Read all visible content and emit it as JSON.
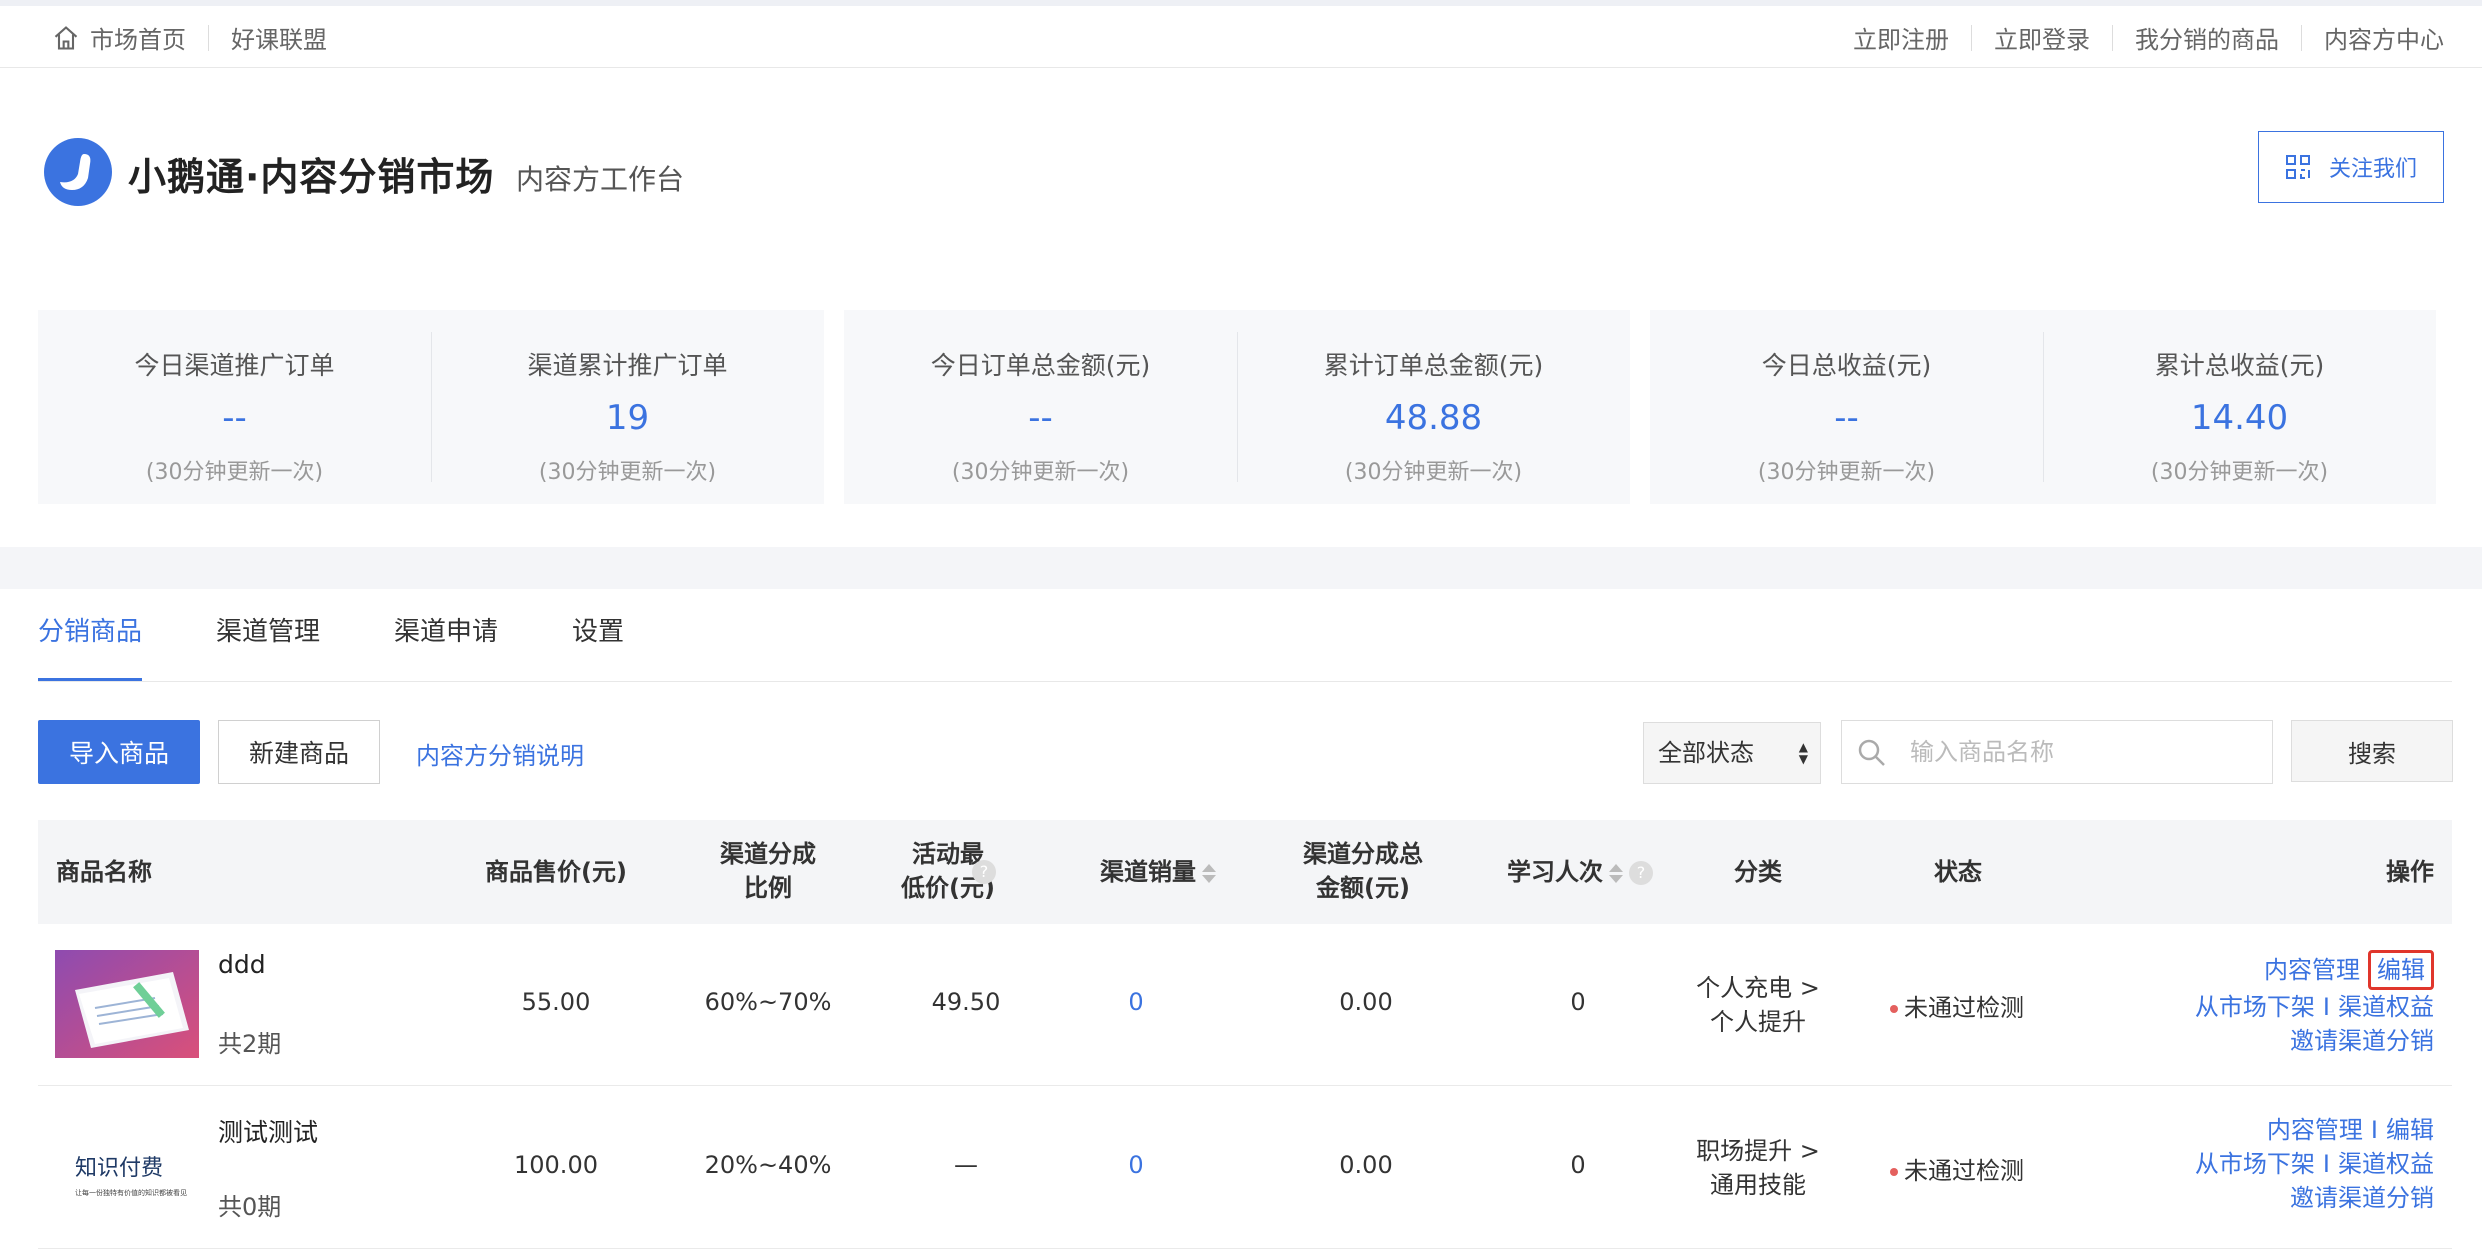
{
  "topbar": {
    "home": "市场首页",
    "alliance": "好课联盟",
    "register": "立即注册",
    "login": "立即登录",
    "my_products": "我分销的商品",
    "content_center": "内容方中心"
  },
  "header": {
    "title": "小鹅通·内容分销市场",
    "subtitle": "内容方工作台",
    "follow": "关注我们"
  },
  "stats": [
    {
      "label": "今日渠道推广订单",
      "value": "--",
      "note": "(30分钟更新一次)"
    },
    {
      "label": "渠道累计推广订单",
      "value": "19",
      "note": "(30分钟更新一次)"
    },
    {
      "label": "今日订单总金额(元)",
      "value": "--",
      "note": "(30分钟更新一次)"
    },
    {
      "label": "累计订单总金额(元)",
      "value": "48.88",
      "note": "(30分钟更新一次)"
    },
    {
      "label": "今日总收益(元)",
      "value": "--",
      "note": "(30分钟更新一次)"
    },
    {
      "label": "累计总收益(元)",
      "value": "14.40",
      "note": "(30分钟更新一次)"
    }
  ],
  "tabs": [
    "分销商品",
    "渠道管理",
    "渠道申请",
    "设置"
  ],
  "toolbar": {
    "import": "导入商品",
    "new": "新建商品",
    "help": "内容方分销说明",
    "status_select": "全部状态",
    "search_placeholder": "输入商品名称",
    "search": "搜索"
  },
  "table": {
    "headers": {
      "name": "商品名称",
      "price": "商品售价(元)",
      "ratio_1": "渠道分成",
      "ratio_2": "比例",
      "min_price_1": "活动最",
      "min_price_2": "低价(元)",
      "sales": "渠道销量",
      "total_1": "渠道分成总",
      "total_2": "金额(元)",
      "learners": "学习人次",
      "category": "分类",
      "status": "状态",
      "ops": "操作"
    },
    "rows": [
      {
        "name": "ddd",
        "periods": "共2期",
        "price": "55.00",
        "ratio": "60%~70%",
        "min_price": "49.50",
        "sales": "0",
        "total": "0.00",
        "learners": "0",
        "category_1": "个人充电 >",
        "category_2": "个人提升",
        "status": "未通过检测",
        "op_manage": "内容管理",
        "op_edit": "编辑",
        "op_delist": "从市场下架",
        "op_rights": "渠道权益",
        "op_invite": "邀请渠道分销",
        "separator": "I"
      },
      {
        "name": "测试测试",
        "periods": "共0期",
        "thumb_title": "知识付费",
        "thumb_caption": "让每一份独特有价值的知识都被看见",
        "price": "100.00",
        "ratio": "20%~40%",
        "min_price": "—",
        "sales": "0",
        "total": "0.00",
        "learners": "0",
        "category_1": "职场提升 >",
        "category_2": "通用技能",
        "status": "未通过检测",
        "op_manage": "内容管理",
        "op_edit": "编辑",
        "op_delist": "从市场下架",
        "op_rights": "渠道权益",
        "op_invite": "邀请渠道分销",
        "separator": "I"
      }
    ]
  },
  "colors": {
    "accent": "#3b73e0",
    "status_fail": "#e4605e",
    "highlight": "#e0362c"
  }
}
